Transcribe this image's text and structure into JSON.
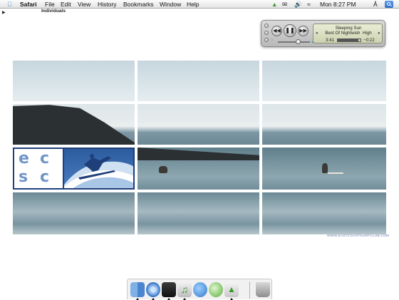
{
  "menubar": {
    "app_name": "Safari",
    "items": [
      "File",
      "Edit",
      "View",
      "History",
      "Bookmarks",
      "Window",
      "Help"
    ],
    "clock": "Mon 8:27 PM"
  },
  "bookmarks_bar": {
    "label": "Individuals"
  },
  "mini_player": {
    "song": "Sleeping Sun",
    "artist": "Best Of Nightwish",
    "volume_high_label": "High",
    "time_elapsed": "3:41",
    "time_remaining": "−0:22",
    "progress": 0.91
  },
  "logo": {
    "letters": [
      "e",
      "c",
      "s",
      "c"
    ]
  },
  "footer": {
    "url": "WWW.EASTCOASTSURFCLUB.COM"
  },
  "dock": {
    "apps": [
      "finder-icon",
      "safari-icon",
      "timer-icon",
      "itunes-icon",
      "ichat-icon",
      "addressbook-icon",
      "download-icon",
      "trash-icon"
    ]
  }
}
